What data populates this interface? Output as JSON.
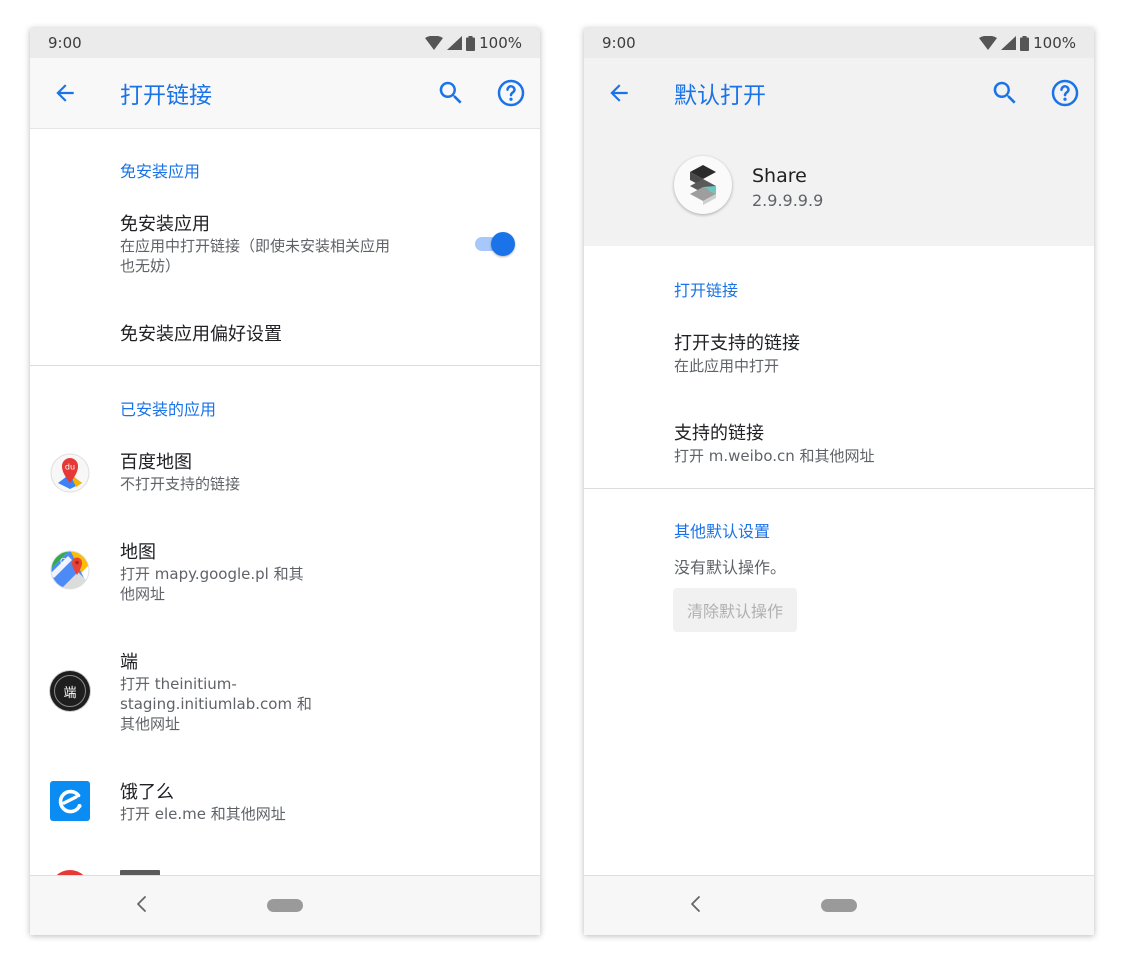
{
  "left_screen": {
    "status": {
      "time": "9:00",
      "battery": "100%"
    },
    "app_bar": {
      "title": "打开链接"
    },
    "instant_apps": {
      "header": "免安装应用",
      "toggle_row": {
        "title": "免安装应用",
        "subtitle_line1": "在应用中打开链接（即使未安装相关应用",
        "subtitle_line2": "也无妨）",
        "enabled": true
      },
      "preferences_label": "免安装应用偏好设置"
    },
    "installed_apps": {
      "header": "已安装的应用",
      "items": [
        {
          "name": "百度地图",
          "lines": [
            "不打开支持的链接"
          ],
          "icon": "baidu-map-icon"
        },
        {
          "name": "地图",
          "lines": [
            "打开 mapy.google.pl 和其",
            "他网址"
          ],
          "icon": "google-maps-icon"
        },
        {
          "name": "端",
          "lines": [
            "打开 theinitium-",
            "staging.initiumlab.com 和",
            "其他网址"
          ],
          "icon": "initium-icon",
          "icon_text": "端"
        },
        {
          "name": "饿了么",
          "lines": [
            "打开 ele.me 和其他网址"
          ],
          "icon": "eleme-icon"
        }
      ]
    }
  },
  "right_screen": {
    "status": {
      "time": "9:00",
      "battery": "100%"
    },
    "app_bar": {
      "title": "默认打开"
    },
    "app_info": {
      "name": "Share",
      "version": "2.9.9.9.9",
      "icon": "share-logo-icon"
    },
    "open_links": {
      "header": "打开链接",
      "supported": {
        "title": "打开支持的链接",
        "subtitle": "在此应用中打开"
      },
      "links": {
        "title": "支持的链接",
        "subtitle": "打开 m.weibo.cn 和其他网址"
      }
    },
    "other_defaults": {
      "header": "其他默认设置",
      "status": "没有默认操作。",
      "clear_button": "清除默认操作"
    }
  },
  "colors": {
    "accent": "#1a73e8",
    "toggle_track": "#a8c7fa",
    "eleme_blue": "#0a8cf2"
  }
}
